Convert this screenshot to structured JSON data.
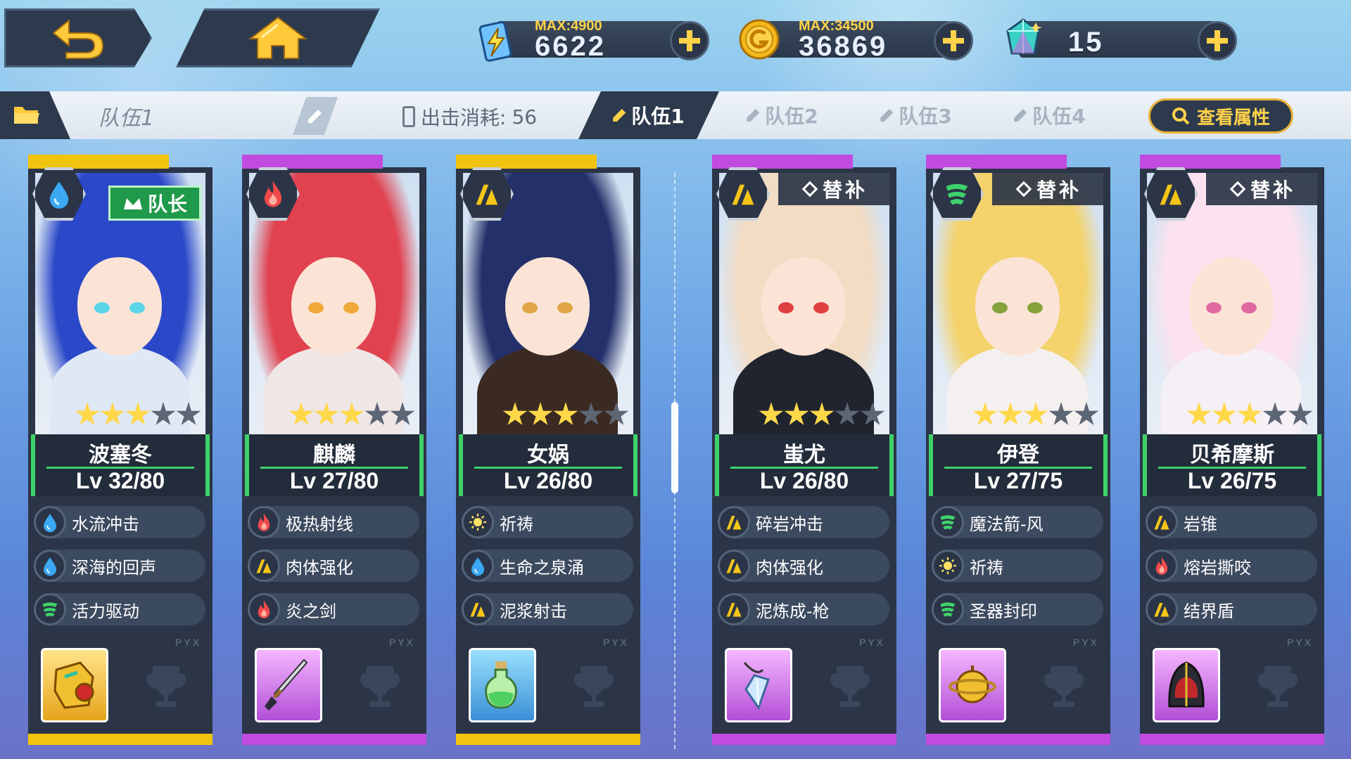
{
  "nav": {
    "back_icon": "back-arrow-icon",
    "home_icon": "home-icon"
  },
  "resources": [
    {
      "id": "stamina",
      "icon": "energy-battery-icon",
      "max_label": "MAX:",
      "max_value": "4900",
      "value": "6622"
    },
    {
      "id": "gold",
      "icon": "gold-coin-icon",
      "max_label": "MAX:",
      "max_value": "34500",
      "value": "36869"
    },
    {
      "id": "crystal",
      "icon": "crystal-icon",
      "max_label": "",
      "max_value": "",
      "value": "15"
    }
  ],
  "teambar": {
    "team_name": "队伍1",
    "cost_label": "出击消耗:",
    "cost_value": "56",
    "tabs": [
      "队伍1",
      "队伍2",
      "队伍3",
      "队伍4"
    ],
    "active_tab": 0,
    "view_attr_label": "查看属性"
  },
  "cards": [
    {
      "name": "波塞冬",
      "level": "Lv 32/80",
      "element": "water",
      "stars": 3,
      "max_stars": 5,
      "tag": "队长",
      "tag_type": "leader",
      "rarity_color": "#f1c40f",
      "skills": [
        {
          "label": "水流冲击",
          "icon": "water"
        },
        {
          "label": "深海的回声",
          "icon": "water"
        },
        {
          "label": "活力驱动",
          "icon": "wind"
        }
      ],
      "equip_icon": "gold-armor-icon",
      "equip_frame": "gold",
      "brand": "PYX"
    },
    {
      "name": "麒麟",
      "level": "Lv 27/80",
      "element": "fire",
      "stars": 3,
      "max_stars": 5,
      "tag": "",
      "tag_type": "none",
      "rarity_color": "#c14bde",
      "skills": [
        {
          "label": "极热射线",
          "icon": "fire"
        },
        {
          "label": "肉体强化",
          "icon": "earth"
        },
        {
          "label": "炎之剑",
          "icon": "fire"
        }
      ],
      "equip_icon": "katana-icon",
      "equip_frame": "purple",
      "brand": "PYX"
    },
    {
      "name": "女娲",
      "level": "Lv 26/80",
      "element": "earth",
      "stars": 3,
      "max_stars": 5,
      "tag": "",
      "tag_type": "none",
      "rarity_color": "#f1c40f",
      "skills": [
        {
          "label": "祈祷",
          "icon": "light"
        },
        {
          "label": "生命之泉涌",
          "icon": "water"
        },
        {
          "label": "泥浆射击",
          "icon": "earth"
        }
      ],
      "equip_icon": "potion-icon",
      "equip_frame": "blue",
      "brand": "PYX"
    },
    {
      "name": "蚩尤",
      "level": "Lv 26/80",
      "element": "earth",
      "stars": 3,
      "max_stars": 5,
      "tag": "替补",
      "tag_type": "sub",
      "rarity_color": "#c14bde",
      "skills": [
        {
          "label": "碎岩冲击",
          "icon": "earth"
        },
        {
          "label": "肉体强化",
          "icon": "earth"
        },
        {
          "label": "泥炼成-枪",
          "icon": "earth"
        }
      ],
      "equip_icon": "pendant-icon",
      "equip_frame": "purple",
      "brand": "PYX"
    },
    {
      "name": "伊登",
      "level": "Lv 27/75",
      "element": "wind",
      "stars": 3,
      "max_stars": 5,
      "tag": "替补",
      "tag_type": "sub",
      "rarity_color": "#c14bde",
      "skills": [
        {
          "label": "魔法箭-风",
          "icon": "wind"
        },
        {
          "label": "祈祷",
          "icon": "light"
        },
        {
          "label": "圣器封印",
          "icon": "wind"
        }
      ],
      "equip_icon": "orb-icon",
      "equip_frame": "purple",
      "brand": "PYX"
    },
    {
      "name": "贝希摩斯",
      "level": "Lv 26/75",
      "element": "earth",
      "stars": 3,
      "max_stars": 5,
      "tag": "替补",
      "tag_type": "sub",
      "rarity_color": "#c14bde",
      "skills": [
        {
          "label": "岩锥",
          "icon": "earth"
        },
        {
          "label": "熔岩撕咬",
          "icon": "fire"
        },
        {
          "label": "结界盾",
          "icon": "earth"
        }
      ],
      "equip_icon": "hood-icon",
      "equip_frame": "purple",
      "brand": "PYX"
    }
  ],
  "colors": {
    "water": "#3aa8f2",
    "fire": "#f04a4a",
    "earth": "#f5c518",
    "wind": "#3ed26a",
    "light": "#ffe066",
    "accent_gold": "#ffd24a",
    "panel": "#2b3547"
  }
}
